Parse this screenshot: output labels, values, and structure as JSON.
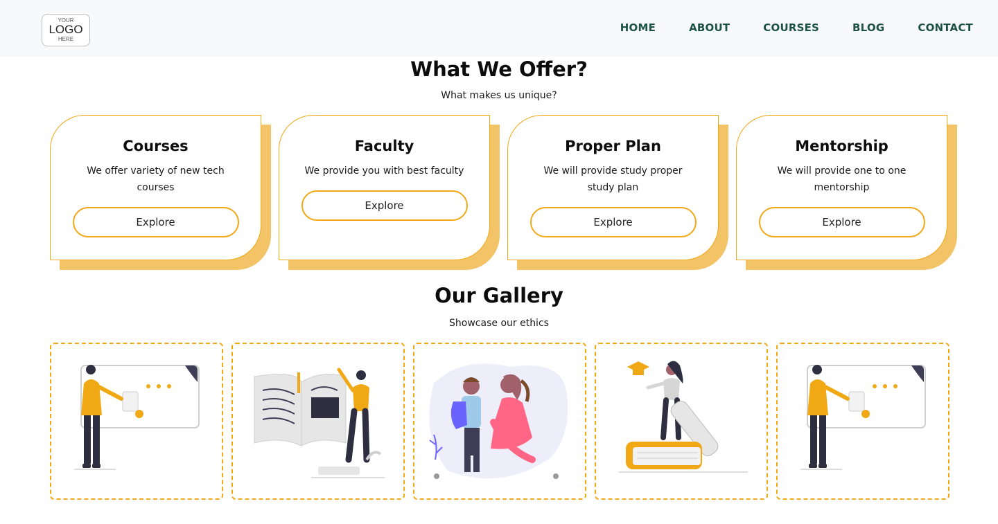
{
  "logo": {
    "line1": "YOUR",
    "line2": "LOGO",
    "line3": "HERE"
  },
  "nav": {
    "items": [
      {
        "label": "HOME"
      },
      {
        "label": "ABOUT"
      },
      {
        "label": "COURSES"
      },
      {
        "label": "BLOG"
      },
      {
        "label": "CONTACT"
      }
    ]
  },
  "offer": {
    "title": "What We Offer?",
    "subtitle": "What makes us unique?",
    "cards": [
      {
        "title": "Courses",
        "text": "We offer variety of new tech courses",
        "button": "Explore"
      },
      {
        "title": "Faculty",
        "text": "We provide you with best faculty",
        "button": "Explore"
      },
      {
        "title": "Proper Plan",
        "text": "We will provide study proper study plan",
        "button": "Explore"
      },
      {
        "title": "Mentorship",
        "text": "We will provide one to one mentorship",
        "button": "Explore"
      }
    ]
  },
  "gallery": {
    "title": "Our Gallery",
    "subtitle": "Showcase our ethics",
    "items": [
      {
        "icon": "presenter-whiteboard-illustration"
      },
      {
        "icon": "open-book-reader-illustration"
      },
      {
        "icon": "mother-child-illustration"
      },
      {
        "icon": "graduate-on-books-illustration"
      },
      {
        "icon": "presenter-whiteboard-illustration"
      }
    ]
  },
  "colors": {
    "accent": "#f0a814",
    "shadow": "#f3c467",
    "nav_text": "#1c5240",
    "nav_bg": "#f8f9fa"
  }
}
